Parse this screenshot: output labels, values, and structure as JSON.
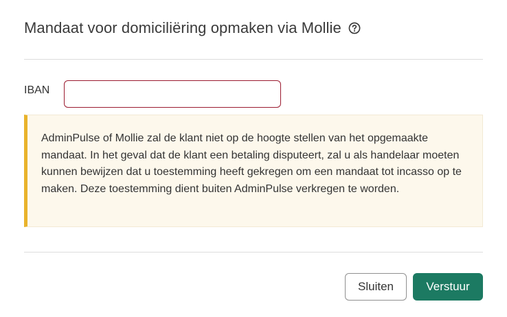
{
  "dialog": {
    "title": "Mandaat voor domiciliëring opmaken via Mollie",
    "help_icon": "question-circle-icon"
  },
  "form": {
    "iban_label": "IBAN",
    "iban_value": "",
    "iban_placeholder": ""
  },
  "notice": {
    "text": "AdminPulse of Mollie zal de klant niet op de hoogte stellen van het opgemaakte mandaat. In het geval dat de klant een betaling disputeert, zal u als handelaar moeten kunnen bewijzen dat u toestemming heeft gekregen om een mandaat tot incasso op te maken. Deze toestemming dient buiten AdminPulse verkregen te worden.",
    "accent_color": "#e9b32c",
    "background_color": "#fdf8ec"
  },
  "footer": {
    "close_label": "Sluiten",
    "submit_label": "Verstuur",
    "primary_color": "#1c7a62"
  },
  "colors": {
    "input_error_border": "#9b1b30"
  }
}
